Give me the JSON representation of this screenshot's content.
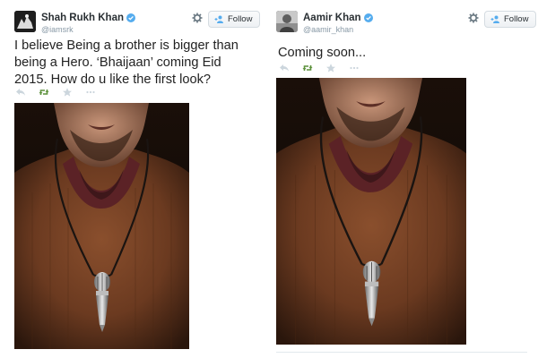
{
  "tweets": [
    {
      "author": {
        "display_name": "Shah Rukh Khan",
        "handle": "@iamsrk"
      },
      "follow_label": "Follow",
      "text": "I believe Being a brother is bigger than being a Hero. ‘Bhaijaan’ coming Eid 2015. How do u like the first look?",
      "actions": [
        "reply-icon",
        "retweet-icon",
        "favorite-icon",
        "more-icon"
      ]
    },
    {
      "author": {
        "display_name": "Aamir Khan",
        "handle": "@aamir_khan"
      },
      "follow_label": "Follow",
      "text": "Coming soon...",
      "actions": [
        "reply-icon",
        "retweet-icon",
        "favorite-icon",
        "more-icon"
      ]
    }
  ],
  "colors": {
    "verified": "#55acee",
    "retweet": "#5c913b",
    "muted_icon": "#ccd6dd",
    "follow_icon": "#55acee"
  }
}
